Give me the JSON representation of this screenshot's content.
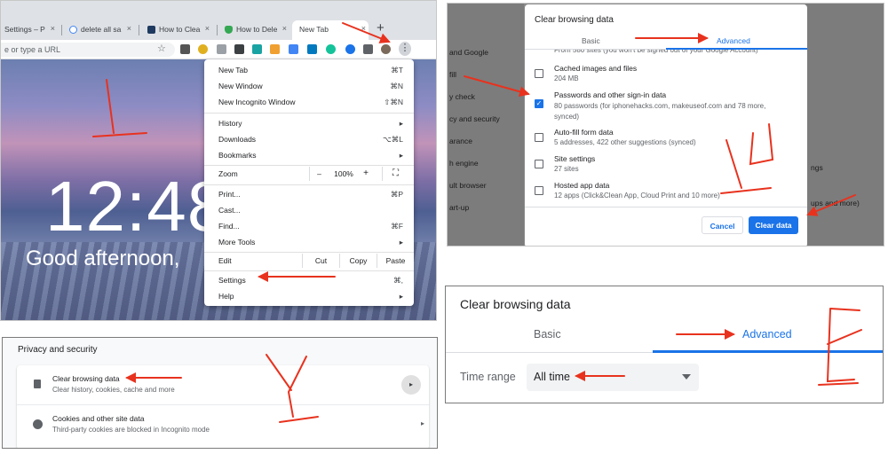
{
  "browser": {
    "tabs": [
      {
        "label": "Settings – P",
        "favicon_color": "#5f6368"
      },
      {
        "label": "delete all sa",
        "favicon_color": "#4285f4"
      },
      {
        "label": "How to Clea",
        "favicon_color": "#1f3a60"
      },
      {
        "label": "How to Dele",
        "favicon_color": "#34a853"
      },
      {
        "label": "New Tab",
        "favicon_color": ""
      }
    ],
    "new_tab_symbol": "+",
    "close_symbol": "×",
    "omnibox_placeholder": "e or type a URL",
    "clock": "12:48",
    "greeting": "Good afternoon,"
  },
  "chrome_menu": {
    "items": [
      {
        "label": "New Tab",
        "shortcut": "⌘T"
      },
      {
        "label": "New Window",
        "shortcut": "⌘N"
      },
      {
        "label": "New Incognito Window",
        "shortcut": "⇧⌘N"
      },
      {
        "label": "History",
        "shortcut": "▸"
      },
      {
        "label": "Downloads",
        "shortcut": "⌥⌘L"
      },
      {
        "label": "Bookmarks",
        "shortcut": "▸"
      },
      {
        "label": "Print...",
        "shortcut": "⌘P"
      },
      {
        "label": "Cast...",
        "shortcut": ""
      },
      {
        "label": "Find...",
        "shortcut": "⌘F"
      },
      {
        "label": "More Tools",
        "shortcut": "▸"
      },
      {
        "label": "Settings",
        "shortcut": "⌘,"
      },
      {
        "label": "Help",
        "shortcut": "▸"
      }
    ],
    "zoom": {
      "label": "Zoom",
      "minus": "–",
      "value": "100%",
      "plus": "+",
      "fullscreen": "⛶"
    },
    "edit": {
      "label": "Edit",
      "cut": "Cut",
      "copy": "Copy",
      "paste": "Paste"
    }
  },
  "settings_sidebar": {
    "left": [
      "and Google",
      "fill",
      "y check",
      "cy and security",
      "arance",
      "h engine",
      "ult browser",
      "art-up"
    ],
    "right": [
      "ngs",
      "ups and more)"
    ]
  },
  "clear_dialog": {
    "title": "Clear browsing data",
    "tabs": {
      "basic": "Basic",
      "advanced": "Advanced"
    },
    "cutoff_text": "From 580 sites (you won't be signed out of your Google Account)",
    "items": [
      {
        "title": "Cached images and files",
        "sub": "204 MB",
        "checked": false
      },
      {
        "title": "Passwords and other sign-in data",
        "sub": "80 passwords (for iphonehacks.com, makeuseof.com and 78 more, synced)",
        "checked": true
      },
      {
        "title": "Auto-fill form data",
        "sub": "5 addresses, 422 other suggestions (synced)",
        "checked": false
      },
      {
        "title": "Site settings",
        "sub": "27 sites",
        "checked": false
      },
      {
        "title": "Hosted app data",
        "sub": "12 apps (Click&Clean App, Cloud Print and 10 more)",
        "checked": false
      }
    ],
    "cancel": "Cancel",
    "confirm": "Clear data"
  },
  "privacy": {
    "heading": "Privacy and security",
    "rows": [
      {
        "title": "Clear browsing data",
        "sub": "Clear history, cookies, cache and more"
      },
      {
        "title": "Cookies and other site data",
        "sub": "Third-party cookies are blocked in Incognito mode"
      }
    ]
  },
  "time_range_panel": {
    "title": "Clear browsing data",
    "tabs": {
      "basic": "Basic",
      "advanced": "Advanced"
    },
    "label": "Time range",
    "value": "All time"
  },
  "colors": {
    "accent": "#1a73e8",
    "annotation_red": "#e8321e"
  }
}
